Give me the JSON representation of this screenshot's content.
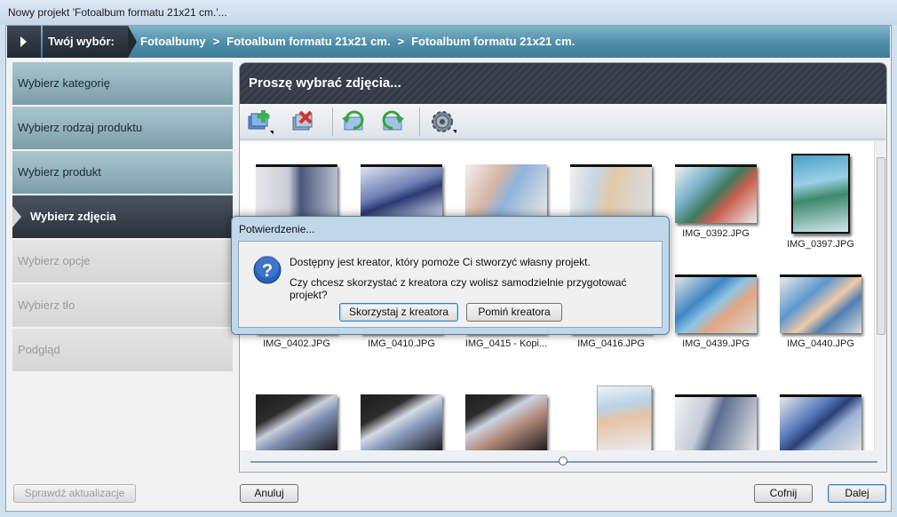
{
  "window": {
    "title": "Nowy projekt 'Fotoalbum formatu 21x21 cm.'..."
  },
  "breadcrumb": {
    "current_label": "Twój wybór:",
    "path": [
      "Fotoalbumy",
      "Fotoalbum formatu 21x21 cm.",
      "Fotoalbum formatu 21x21 cm."
    ],
    "separator": ">"
  },
  "steps": [
    {
      "label": "Wybierz kategorię",
      "state": "done"
    },
    {
      "label": "Wybierz rodzaj produktu",
      "state": "done"
    },
    {
      "label": "Wybierz produkt",
      "state": "done"
    },
    {
      "label": "Wybierz zdjęcia",
      "state": "active"
    },
    {
      "label": "Wybierz opcje",
      "state": "todo"
    },
    {
      "label": "Wybierz tło",
      "state": "todo"
    },
    {
      "label": "Podgląd",
      "state": "todo"
    }
  ],
  "panel": {
    "title": "Proszę wybrać zdjęcia..."
  },
  "toolbar": {
    "icons": [
      "add-photos-icon",
      "remove-photos-icon",
      "rotate-left-icon",
      "rotate-right-icon",
      "settings-icon"
    ]
  },
  "photos": [
    {
      "caption": ""
    },
    {
      "caption": ""
    },
    {
      "caption": ""
    },
    {
      "caption": ""
    },
    {
      "caption": "IMG_0392.JPG"
    },
    {
      "caption": "IMG_0397.JPG"
    },
    {
      "caption": "IMG_0402.JPG"
    },
    {
      "caption": "IMG_0410.JPG"
    },
    {
      "caption": "IMG_0415 - Kopi..."
    },
    {
      "caption": "IMG_0416.JPG"
    },
    {
      "caption": "IMG_0439.JPG"
    },
    {
      "caption": "IMG_0440.JPG"
    },
    {
      "caption": ""
    },
    {
      "caption": ""
    },
    {
      "caption": ""
    },
    {
      "caption": ""
    },
    {
      "caption": ""
    },
    {
      "caption": ""
    }
  ],
  "buttons": {
    "check_updates": "Sprawdź aktualizacje",
    "cancel": "Anuluj",
    "back": "Cofnij",
    "next": "Dalej"
  },
  "dialog": {
    "title": "Potwierdzenie...",
    "message_line1": "Dostępny jest kreator, który pomoże Ci stworzyć własny projekt.",
    "message_line2": "Czy chcesz skorzystać z kreatora czy wolisz samodzielnie przygotować projekt?",
    "use_wizard": "Skorzystaj z kreatora",
    "skip_wizard": "Pomiń kreatora"
  },
  "colors": {
    "accent": "#3f7d98",
    "active_step": "#2b323b"
  }
}
